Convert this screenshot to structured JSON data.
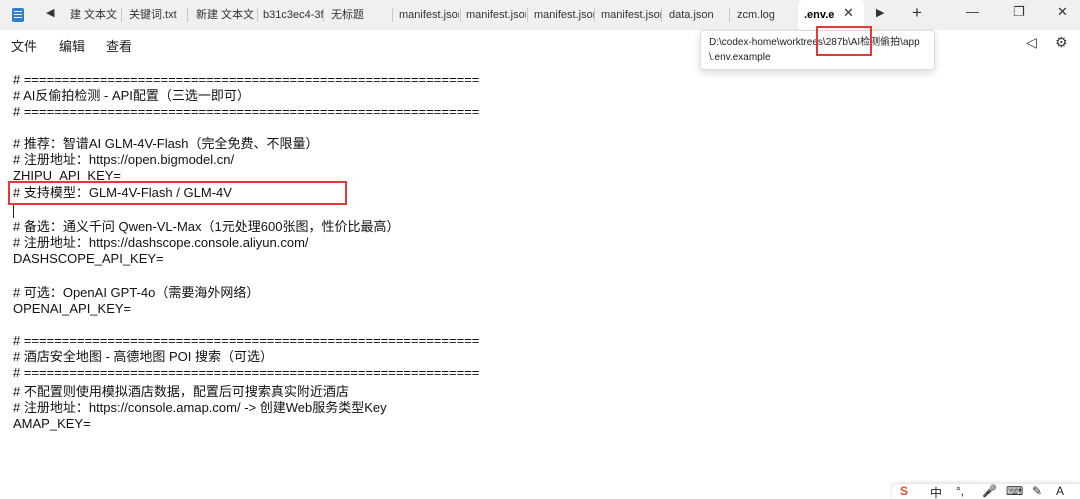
{
  "tabs": [
    {
      "label": "建 文本文ｌ"
    },
    {
      "label": "关键词.txt"
    },
    {
      "label": "新建 文本文ｌ"
    },
    {
      "label": "b31c3ec4-3f"
    },
    {
      "label": "无标题"
    },
    {
      "label": "manifest.jsor"
    },
    {
      "label": "manifest.jsor"
    },
    {
      "label": "manifest.jsor"
    },
    {
      "label": "manifest.jsor"
    },
    {
      "label": "data.json"
    },
    {
      "label": "zcm.log"
    },
    {
      "label": ".env.e"
    }
  ],
  "icons": {
    "app": "notepad-icon",
    "scroll_left": "◀",
    "scroll_right": "▶",
    "close": "✕",
    "new_tab": "+",
    "minimize": "—",
    "maximize": "❐",
    "window_close": "✕",
    "feedback": "◁",
    "settings": "⚙"
  },
  "menu": {
    "file": "文件",
    "edit": "编辑",
    "view": "查看"
  },
  "tooltip": {
    "line1": "D:\\codex-home\\worktrees\\287b\\AI检测偷拍\\app",
    "line2": "\\.env.example"
  },
  "editor_lines": [
    "# ============================================================",
    "# AI反偷拍检测 - API配置（三选一即可）",
    "# ============================================================",
    "",
    "# 推荐：智谱AI GLM-4V-Flash（完全免费、不限量）",
    "# 注册地址：https://open.bigmodel.cn/",
    "ZHIPU_API_KEY=",
    "# 支持模型：GLM-4V-Flash / GLM-4V",
    "",
    "# 备选：通义千问 Qwen-VL-Max（1元处理600张图，性价比最高）",
    "# 注册地址：https://dashscope.console.aliyun.com/",
    "DASHSCOPE_API_KEY=",
    "",
    "# 可选：OpenAI GPT-4o（需要海外网络）",
    "OPENAI_API_KEY=",
    "",
    "# ============================================================",
    "# 酒店安全地图 - 高德地图 POI 搜索（可选）",
    "# ============================================================",
    "# 不配置则使用模拟酒店数据，配置后可搜索真实附近酒店",
    "# 注册地址：https://console.amap.com/ -> 创建Web服务类型Key",
    "AMAP_KEY="
  ],
  "ime": {
    "logo": "S",
    "lang": "中",
    "punct": "°,",
    "mic": "🎤",
    "keyboard": "⌨",
    "brush": "✎",
    "text": "A"
  },
  "colors": {
    "highlight": "#e53935",
    "tabbar": "#f0f0f0",
    "ime_logo": "#e8502a"
  }
}
